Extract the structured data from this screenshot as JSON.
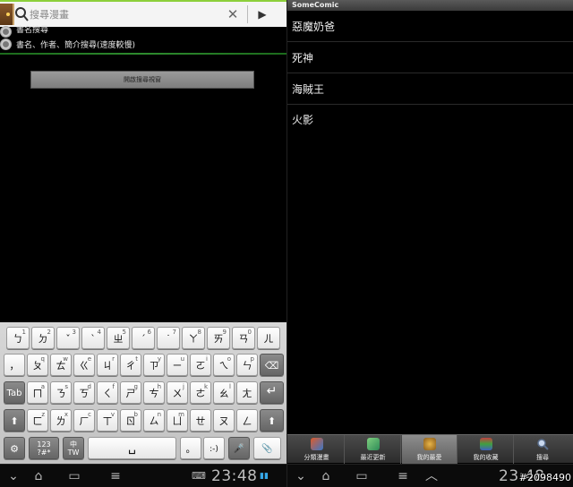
{
  "left": {
    "search": {
      "placeholder": "搜尋漫畫",
      "clear_glyph": "✕",
      "go_glyph": "▶"
    },
    "options": [
      {
        "label": "書名搜尋",
        "selected": false
      },
      {
        "label": "書名、作者、簡介搜尋(速度較慢)",
        "selected": false
      }
    ],
    "open_button": "開啟搜尋視窗",
    "keyboard": {
      "row1": [
        {
          "main": "ㄅ",
          "sup": "1"
        },
        {
          "main": "ㄉ",
          "sup": "2"
        },
        {
          "main": "ˇ",
          "sup": "3"
        },
        {
          "main": "ˋ",
          "sup": "4"
        },
        {
          "main": "ㄓ",
          "sup": "5"
        },
        {
          "main": "ˊ",
          "sup": "6"
        },
        {
          "main": "˙",
          "sup": "7"
        },
        {
          "main": "ㄚ",
          "sup": "8"
        },
        {
          "main": "ㄞ",
          "sup": "9"
        },
        {
          "main": "ㄢ",
          "sup": "0"
        },
        {
          "main": "ㄦ",
          "sup": ""
        }
      ],
      "row2": [
        {
          "main": "，",
          "sup": ""
        },
        {
          "main": "ㄆ",
          "sup": "q"
        },
        {
          "main": "ㄊ",
          "sup": "w"
        },
        {
          "main": "ㄍ",
          "sup": "e"
        },
        {
          "main": "ㄐ",
          "sup": "r"
        },
        {
          "main": "ㄔ",
          "sup": "t"
        },
        {
          "main": "ㄗ",
          "sup": "y"
        },
        {
          "main": "ㄧ",
          "sup": "u"
        },
        {
          "main": "ㄛ",
          "sup": "i"
        },
        {
          "main": "ㄟ",
          "sup": "o"
        },
        {
          "main": "ㄣ",
          "sup": "p"
        }
      ],
      "row3": [
        {
          "main": "ㄇ",
          "sup": "a"
        },
        {
          "main": "ㄋ",
          "sup": "s"
        },
        {
          "main": "ㄎ",
          "sup": "d"
        },
        {
          "main": "ㄑ",
          "sup": "f"
        },
        {
          "main": "ㄕ",
          "sup": "g"
        },
        {
          "main": "ㄘ",
          "sup": "h"
        },
        {
          "main": "ㄨ",
          "sup": "j"
        },
        {
          "main": "ㄜ",
          "sup": "k"
        },
        {
          "main": "ㄠ",
          "sup": "l"
        },
        {
          "main": "ㄤ",
          "sup": ""
        }
      ],
      "row4": [
        {
          "main": "ㄈ",
          "sup": "z"
        },
        {
          "main": "ㄌ",
          "sup": "x"
        },
        {
          "main": "ㄏ",
          "sup": "c"
        },
        {
          "main": "ㄒ",
          "sup": "v"
        },
        {
          "main": "ㄖ",
          "sup": "b"
        },
        {
          "main": "ㄙ",
          "sup": "n"
        },
        {
          "main": "ㄩ",
          "sup": "m"
        },
        {
          "main": "ㄝ",
          "sup": ""
        },
        {
          "main": "ㄡ",
          "sup": ""
        },
        {
          "main": "ㄥ",
          "sup": ""
        }
      ],
      "tab_label": "Tab",
      "backspace_glyph": "⌫",
      "enter_glyph": "↵",
      "shift_glyph": "⬆",
      "settings_glyph": "⚙",
      "symbols_label": "123\n?#*",
      "lang_label": "中\nTW",
      "space_glyph": "␣",
      "period_label": "。",
      "emoji_label": ":-)",
      "mic_glyph": "🎤",
      "clip_glyph": "📎"
    },
    "nav": {
      "back": "⌄",
      "home": "⌂",
      "recent": "▭",
      "menu": "≡",
      "clock": "23:48"
    }
  },
  "right": {
    "app_title": "SomeComic",
    "comics": [
      "惡魔奶爸",
      "死神",
      "海賊王",
      "火影"
    ],
    "tabs": [
      {
        "label": "分類漫畫",
        "icon": "category-icon",
        "color": "#e05a2a",
        "active": false
      },
      {
        "label": "最近更新",
        "icon": "update-icon",
        "color": "#4cb04c",
        "active": false
      },
      {
        "label": "我的最愛",
        "icon": "favorite-icon",
        "color": "#c8a040",
        "active": true
      },
      {
        "label": "我的收藏",
        "icon": "collection-icon",
        "color": "#c04040",
        "active": false
      },
      {
        "label": "搜尋",
        "icon": "search-icon",
        "color": "#8fa7c8",
        "active": false
      }
    ],
    "nav": {
      "back": "⌄",
      "home": "⌂",
      "recent": "▭",
      "menu": "≡",
      "up": "︿",
      "clock": "23:48"
    }
  },
  "watermark": "#2098490"
}
